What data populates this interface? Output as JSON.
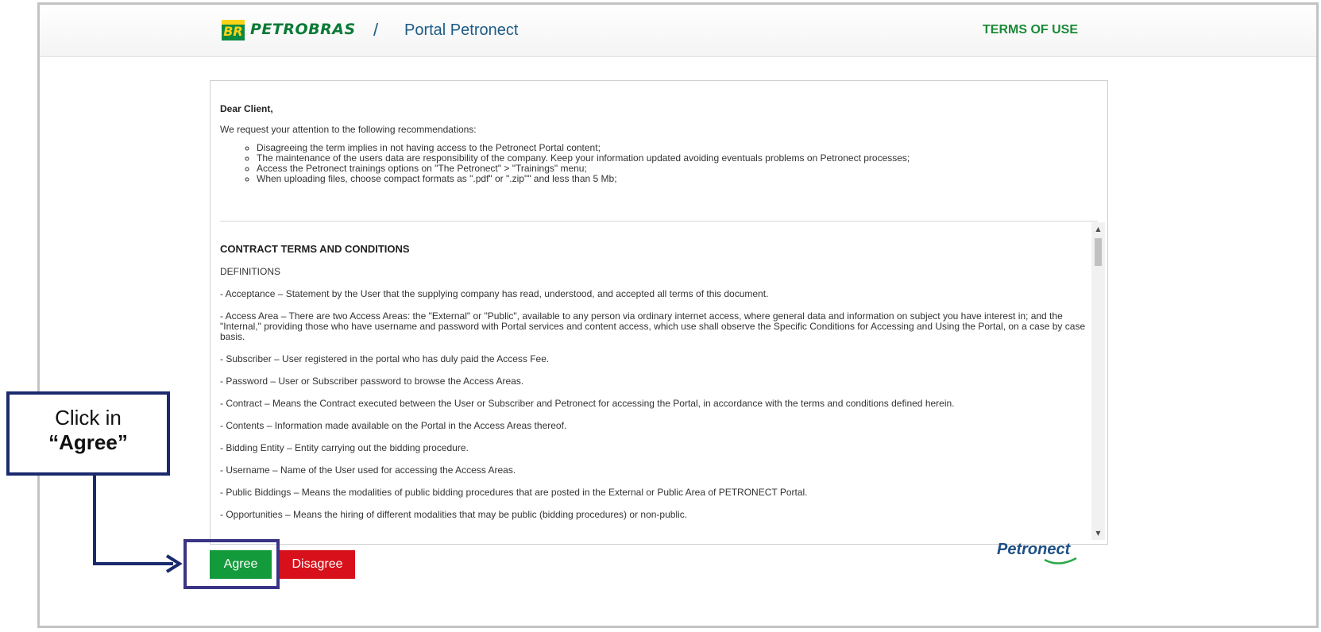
{
  "header": {
    "logo_mark": "BR",
    "brand": "PETROBRAS",
    "separator": "/",
    "portal": "Portal Petronect",
    "terms_link": "TERMS OF USE"
  },
  "recommendations": {
    "greeting": "Dear Client,",
    "intro": "We request your attention to the following recommendations:",
    "items": [
      "Disagreeing the term implies in not having access to the Petronect Portal content;",
      "The maintenance of the users data are responsibility of the company. Keep your information updated avoiding eventuals problems on Petronect processes;",
      "Access the Petronect trainings options on \"The Petronect\" > \"Trainings\" menu;",
      "When uploading files, choose compact formats as \".pdf\" or \".zip\"\" and less than 5 Mb;"
    ]
  },
  "terms": {
    "title": "CONTRACT TERMS AND CONDITIONS",
    "paragraphs": [
      "DEFINITIONS",
      "- Acceptance – Statement by the User that the supplying company has read, understood, and accepted all terms of this document.",
      "- Access Area – There are two Access Areas: the \"External\" or \"Public\", available to any person via ordinary internet access, where general data and information on subject you have interest in; and the \"Internal,\" providing those who have username and password with Portal services and content access, which use shall observe the Specific Conditions for Accessing and Using the Portal, on a case by case basis.",
      "- Subscriber – User registered in the portal who has duly paid the Access Fee.",
      "- Password – User or Subscriber password to browse the Access Areas.",
      "- Contract – Means the Contract executed between the User or Subscriber and Petronect for accessing the Portal, in accordance with the terms and conditions defined herein.",
      "- Contents – Information made available on the Portal in the Access Areas thereof.",
      "- Bidding Entity – Entity carrying out the bidding procedure.",
      "- Username – Name of the User used for accessing the Access Areas.",
      "- Public Biddings – Means the modalities of public bidding procedures that are posted in the External or Public Area of PETRONECT Portal.",
      "- Opportunities – Means the hiring of different modalities that may be public (bidding procedures) or non-public."
    ]
  },
  "buttons": {
    "agree": "Agree",
    "disagree": "Disagree"
  },
  "footer": {
    "logo_text": "Petronect"
  },
  "callout": {
    "line1": "Click in",
    "line2": "“Agree”"
  },
  "colors": {
    "brand_green": "#0a7a36",
    "brand_yellow": "#f9d21a",
    "portal_blue": "#1d5b86",
    "agree_green": "#139a3b",
    "disagree_red": "#d8101b",
    "callout_navy": "#1b2a6e"
  }
}
